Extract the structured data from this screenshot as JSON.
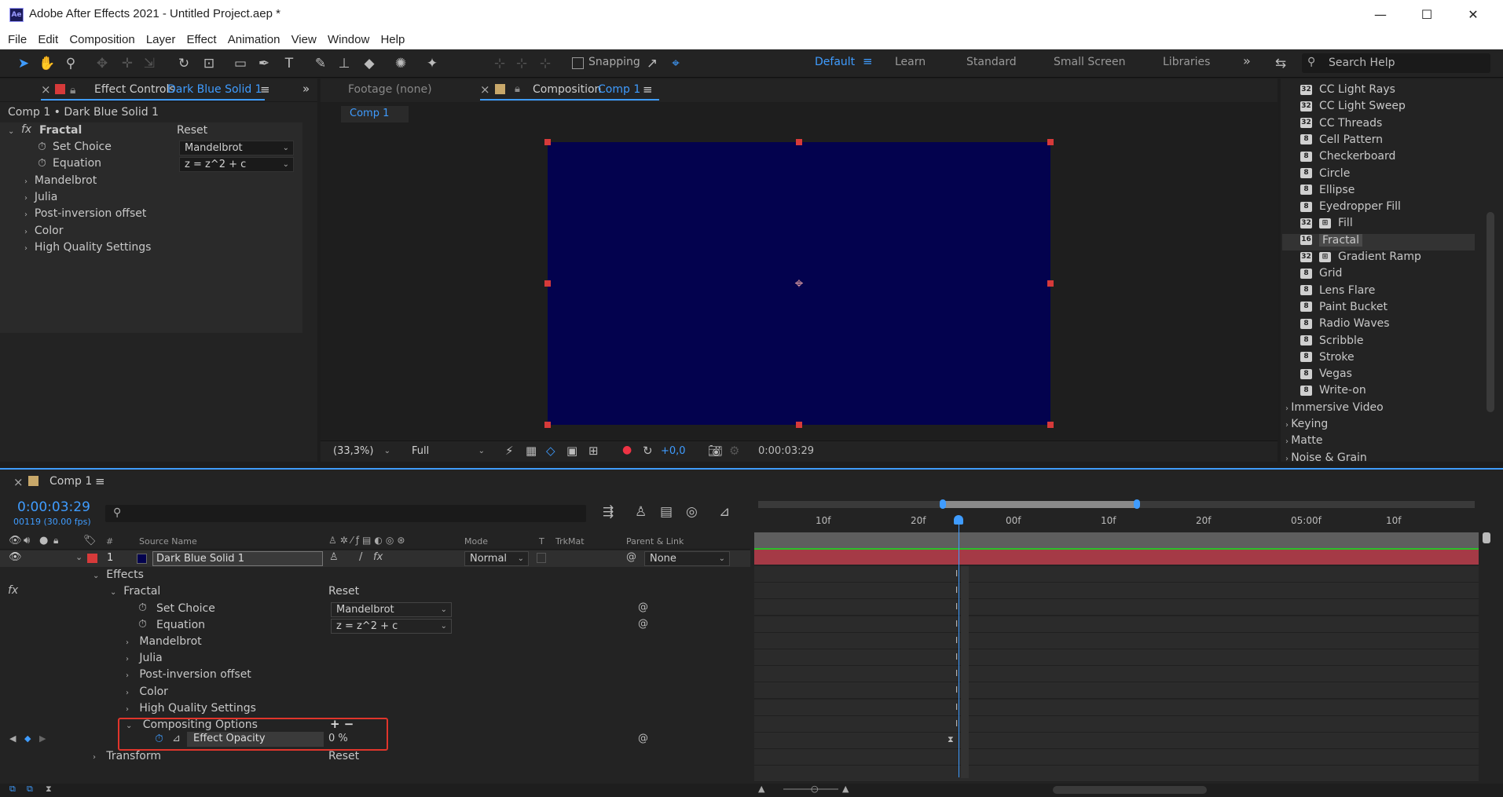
{
  "window": {
    "title": "Adobe After Effects 2021 - Untitled Project.aep *",
    "logo": "Ae",
    "minimize": "—",
    "maximize": "☐",
    "close": "✕"
  },
  "menu": [
    "File",
    "Edit",
    "Composition",
    "Layer",
    "Effect",
    "Animation",
    "View",
    "Window",
    "Help"
  ],
  "toolbar": {
    "snapping_label": "Snapping",
    "workspaces": [
      "Default",
      "Learn",
      "Standard",
      "Small Screen",
      "Libraries"
    ],
    "active_workspace": "Default",
    "more": "»",
    "search_placeholder": "Search Help"
  },
  "effect_controls": {
    "close": "×",
    "tab_label": "Effect Controls",
    "layer_name": "Dark Blue Solid 1",
    "breadcrumb": "Comp 1 • Dark Blue Solid 1",
    "fx_label": "fx",
    "effect_name": "Fractal",
    "reset": "Reset",
    "set_choice_label": "Set Choice",
    "set_choice_value": "Mandelbrot",
    "equation_label": "Equation",
    "equation_value": "z = z^2 + c",
    "groups": [
      "Mandelbrot",
      "Julia",
      "Post-inversion offset",
      "Color",
      "High Quality Settings"
    ],
    "collapse": "»"
  },
  "viewer": {
    "footage_tab": "Footage",
    "footage_value": "(none)",
    "comp_tab": "Composition",
    "comp_name": "Comp 1",
    "comp_chip": "Comp 1",
    "zoom": "(33,3%)",
    "resolution": "Full",
    "exposure": "+0,0",
    "timecode": "0:00:03:29",
    "solid_color": "#03024e"
  },
  "effects_presets": {
    "items": [
      "CC Light Rays",
      "CC Light Sweep",
      "CC Threads",
      "Cell Pattern",
      "Checkerboard",
      "Circle",
      "Ellipse",
      "Eyedropper Fill",
      "Fill",
      "Fractal",
      "Gradient Ramp",
      "Grid",
      "Lens Flare",
      "Paint Bucket",
      "Radio Waves",
      "Scribble",
      "Stroke",
      "Vegas",
      "Write-on"
    ],
    "badges": [
      "32",
      "32",
      "32",
      "8",
      "8",
      "8",
      "8",
      "8",
      "32",
      "16",
      "32",
      "8",
      "8",
      "8",
      "8",
      "8",
      "8",
      "8",
      "8"
    ],
    "selected": "Fractal",
    "categories": [
      "Immersive Video",
      "Keying",
      "Matte",
      "Noise & Grain"
    ]
  },
  "timeline": {
    "close": "×",
    "comp_name": "Comp 1",
    "timecode": "0:00:03:29",
    "frame_info": "00119 (30.00 fps)",
    "search_glyph": "⚲",
    "columns": {
      "source_name": "Source Name",
      "hash": "#",
      "mode": "Mode",
      "t": "T",
      "trkmat": "TrkMat",
      "parent": "Parent & Link"
    },
    "layer": {
      "index": "1",
      "name": "Dark Blue Solid 1",
      "mode": "Normal",
      "parent": "None",
      "fx_switch": "fx",
      "quality_switch": "/"
    },
    "tree": {
      "effects": "Effects",
      "fx_label": "fx",
      "fractal": "Fractal",
      "reset": "Reset",
      "set_choice_label": "Set Choice",
      "set_choice_value": "Mandelbrot",
      "equation_label": "Equation",
      "equation_value": "z = z^2 + c",
      "groups": [
        "Mandelbrot",
        "Julia",
        "Post-inversion offset",
        "Color",
        "High Quality Settings"
      ],
      "compositing_options": "Compositing Options",
      "plus_minus": "+ −",
      "effect_opacity_label": "Effect Opacity",
      "effect_opacity_value": "0 %",
      "transform": "Transform",
      "transform_reset": "Reset"
    },
    "ruler_labels": [
      "10f",
      "20f",
      "00f",
      "10f",
      "20f",
      "05:00f",
      "10f"
    ],
    "playhead_fraction": 0.282,
    "work_area_start": 0.282,
    "work_area_end": 0.55
  },
  "colors": {
    "accent": "#3f9cff",
    "layer_label": "#d63a3a",
    "highlight_box": "#e0352b"
  }
}
